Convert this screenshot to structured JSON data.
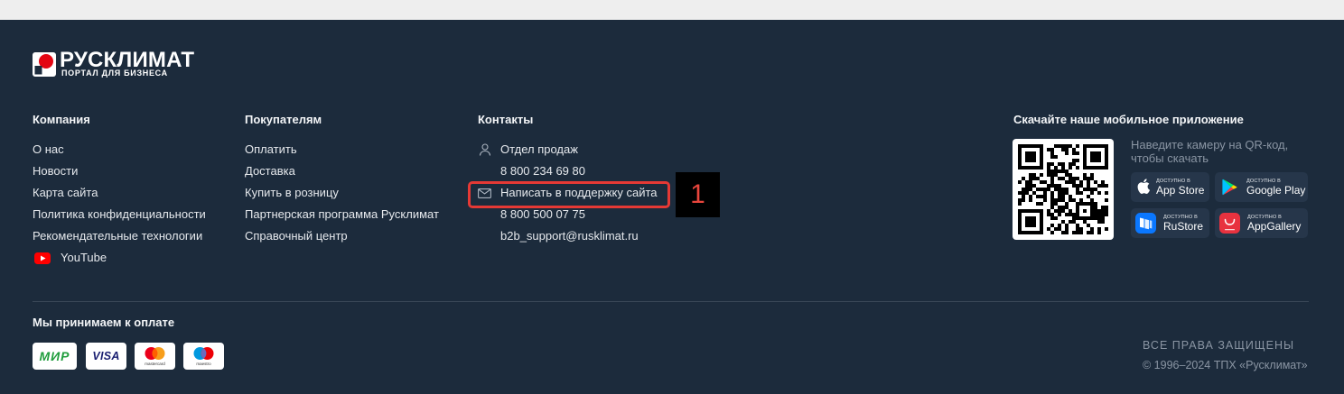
{
  "brand": {
    "name": "РУСКЛИМАТ",
    "tagline": "ПОРТАЛ ДЛЯ БИЗНЕСА",
    "icon": "rusklimat-logo-icon"
  },
  "company": {
    "title": "Компания",
    "links": [
      "О нас",
      "Новости",
      "Карта сайта",
      "Политика конфиденциальности",
      "Рекомендательные технологии"
    ],
    "youtube": {
      "label": "YouTube",
      "icon": "youtube-icon"
    }
  },
  "buyers": {
    "title": "Покупателям",
    "links": [
      "Оплатить",
      "Доставка",
      "Купить в розницу",
      "Партнерская программа Русклимат",
      "Справочный центр"
    ]
  },
  "contacts": {
    "title": "Контакты",
    "sales_label": "Отдел продаж",
    "sales_icon": "person-icon",
    "sales_phone": "8 800 234 69 80",
    "support_label": "Написать в поддержку сайта",
    "support_icon": "mail-icon",
    "support_phone": "8 800 500 07 75",
    "support_email": "b2b_support@rusklimat.ru"
  },
  "annotation": {
    "label": "1"
  },
  "mobile_app": {
    "title": "Скачайте наше мобильное приложение",
    "qr_icon": "qr-code",
    "hint": "Наведите камеру на QR-код, чтобы скачать",
    "stores": [
      {
        "caption": "ДОСТУПНО В",
        "name": "App Store",
        "icon": "apple-icon"
      },
      {
        "caption": "ДОСТУПНО В",
        "name": "Google Play",
        "icon": "google-play-icon"
      },
      {
        "caption": "ДОСТУПНО В",
        "name": "RuStore",
        "icon": "rustore-icon"
      },
      {
        "caption": "ДОСТУПНО В",
        "name": "AppGallery",
        "icon": "appgallery-icon"
      }
    ]
  },
  "payments": {
    "title": "Мы принимаем к оплате",
    "cards": [
      {
        "name": "МИР",
        "icon": "mir-logo"
      },
      {
        "name": "VISA",
        "icon": "visa-logo"
      },
      {
        "name": "mastercard",
        "icon": "mastercard-logo"
      },
      {
        "name": "maestro",
        "icon": "maestro-logo"
      }
    ]
  },
  "legal": {
    "rights": "ВСЕ ПРАВА ЗАЩИЩЕНЫ",
    "copyright": "© 1996–2024 ТПХ «Русклимат»"
  },
  "colors": {
    "page_top": "#eeeeee",
    "footer_bg": "#1c2b3c",
    "text": "#e6e9ed",
    "heading": "#f3f5f7",
    "muted": "#8a95a3",
    "icon": "#aab3bf",
    "badge_bg": "#26364a",
    "divider": "#3a4858",
    "highlight": "#e53935",
    "annotation": "#e8453c"
  }
}
